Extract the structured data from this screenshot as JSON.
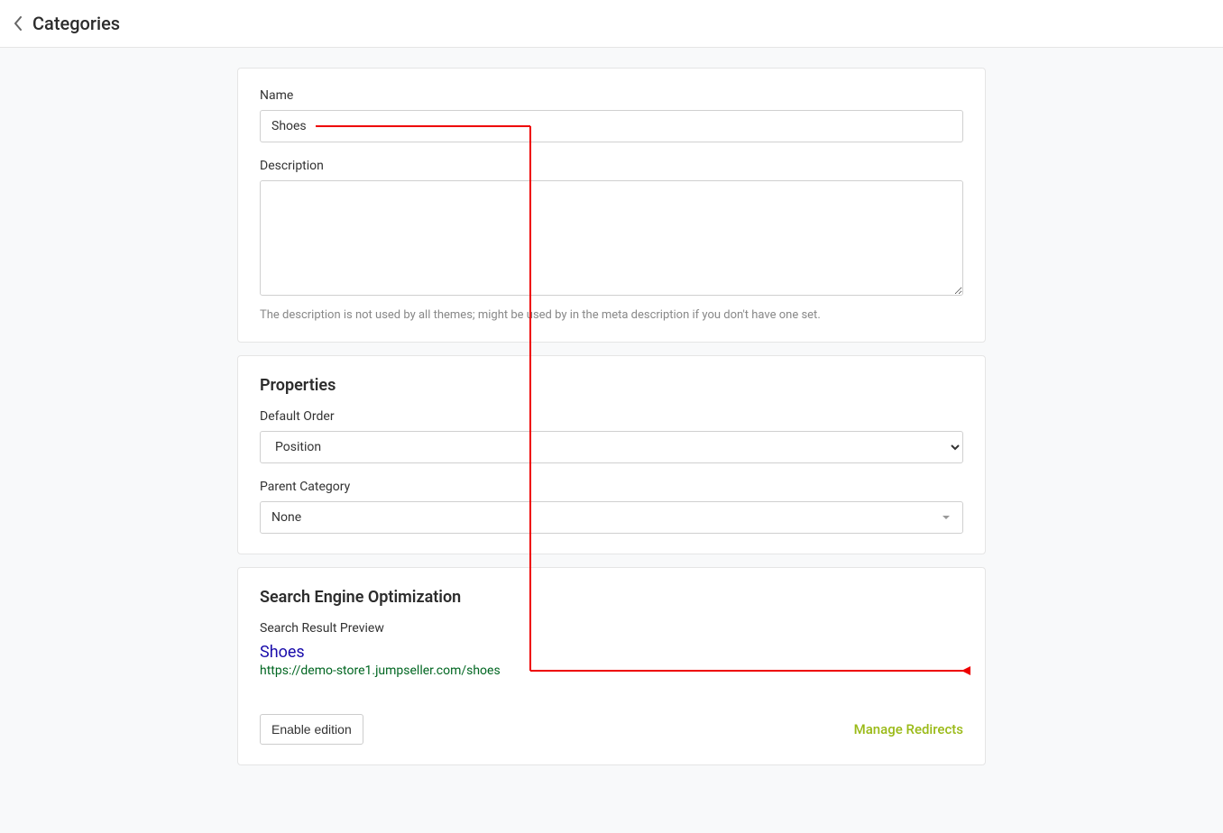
{
  "header": {
    "title": "Categories"
  },
  "basic": {
    "name_label": "Name",
    "name_value": "Shoes",
    "description_label": "Description",
    "description_value": "",
    "description_help": "The description is not used by all themes; might be used by in the meta description if you don't have one set."
  },
  "properties": {
    "title": "Properties",
    "default_order_label": "Default Order",
    "default_order_value": "Position",
    "parent_category_label": "Parent Category",
    "parent_category_value": "None"
  },
  "seo": {
    "title": "Search Engine Optimization",
    "preview_label": "Search Result Preview",
    "preview_title": "Shoes",
    "preview_url": "https://demo-store1.jumpseller.com/shoes",
    "enable_edition_label": "Enable edition",
    "manage_redirects_label": "Manage Redirects"
  }
}
